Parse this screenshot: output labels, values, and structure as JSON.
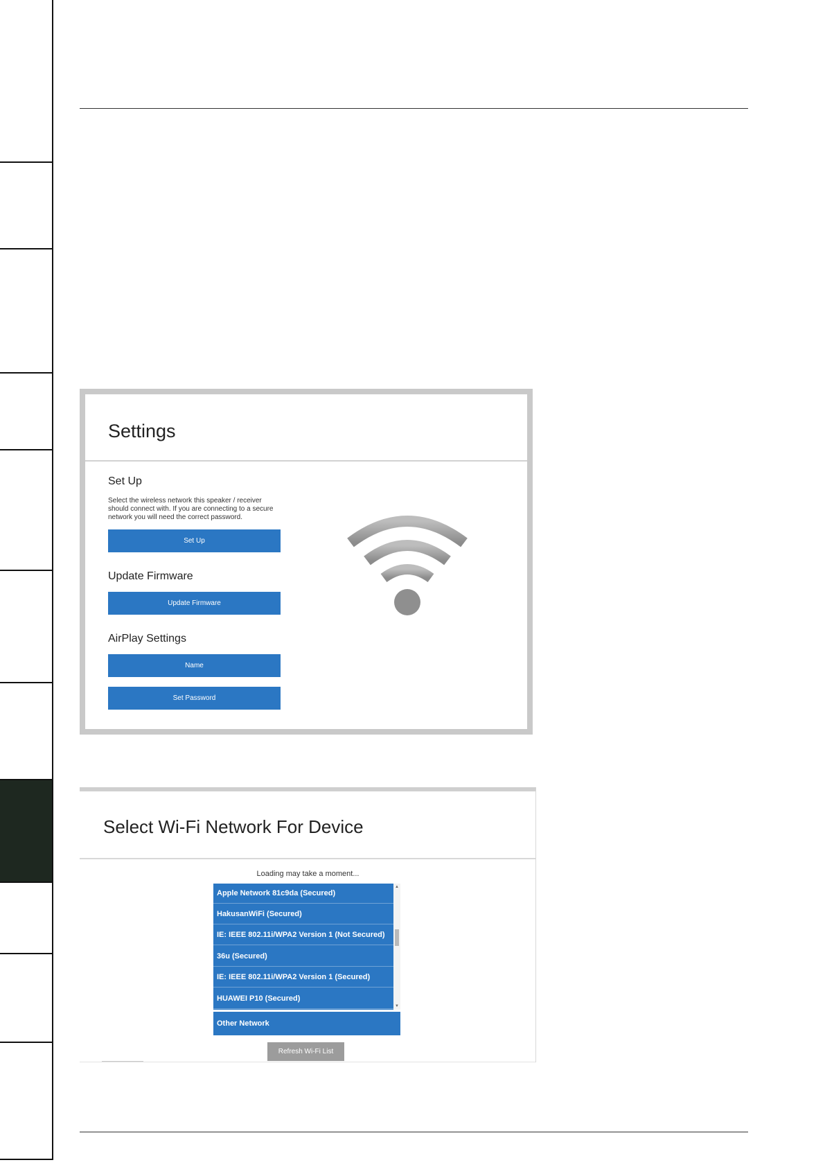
{
  "settings_panel": {
    "title": "Settings",
    "setup": {
      "heading": "Set Up",
      "description": "Select the wireless network this speaker / receiver should connect with. If you are connecting to a secure network you will need the correct password.",
      "button_label": "Set Up"
    },
    "firmware": {
      "heading": "Update Firmware",
      "button_label": "Update Firmware"
    },
    "airplay": {
      "heading": "AirPlay Settings",
      "name_button_label": "Name",
      "password_button_label": "Set Password"
    },
    "graphic_icon": "wifi-icon"
  },
  "wifi_panel": {
    "title": "Select Wi-Fi Network For Device",
    "loading_text": "Loading may take a moment...",
    "networks": [
      "Apple Network 81c9da  (Secured)",
      "HakusanWiFi  (Secured)",
      "IE: IEEE 802.11i/WPA2 Version 1  (Not Secured)",
      "36u  (Secured)",
      "IE: IEEE 802.11i/WPA2 Version 1  (Secured)",
      "HUAWEI P10  (Secured)"
    ],
    "other_network_label": "Other Network",
    "refresh_button_label": "Refresh Wi-Fi List"
  },
  "colors": {
    "button_blue": "#2b77c3",
    "active_tab": "#1e2820",
    "frame_gray": "#c9c9c9"
  }
}
